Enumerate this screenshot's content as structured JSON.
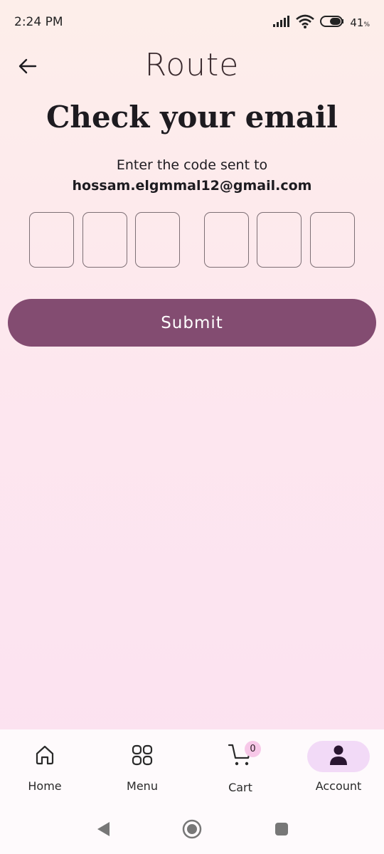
{
  "status_bar": {
    "time": "2:24 PM",
    "battery": "41",
    "battery_unit": "%",
    "icons": [
      "signal-icon",
      "wifi-icon",
      "battery-icon"
    ]
  },
  "header": {
    "back_icon": "arrow-left-icon",
    "logo": "Route"
  },
  "content": {
    "title": "Check your email",
    "instruction": "Enter the code sent to",
    "email": "hossam.elgmmal12@gmail.com",
    "code_values": [
      "",
      "",
      "",
      "",
      "",
      ""
    ],
    "submit_label": "Submit"
  },
  "bottom_nav": {
    "items": [
      {
        "label": "Home",
        "icon": "home-icon",
        "active": false
      },
      {
        "label": "Menu",
        "icon": "grid-icon",
        "active": false
      },
      {
        "label": "Cart",
        "icon": "cart-icon",
        "active": false,
        "badge": "0"
      },
      {
        "label": "Account",
        "icon": "person-icon",
        "active": true
      }
    ]
  },
  "system_nav": [
    "back-triangle-icon",
    "home-circle-icon",
    "recents-square-icon"
  ],
  "colors": {
    "primary": "#834c71",
    "active_nav_bg": "#f2daf7",
    "badge_bg": "#f7c8e8"
  }
}
